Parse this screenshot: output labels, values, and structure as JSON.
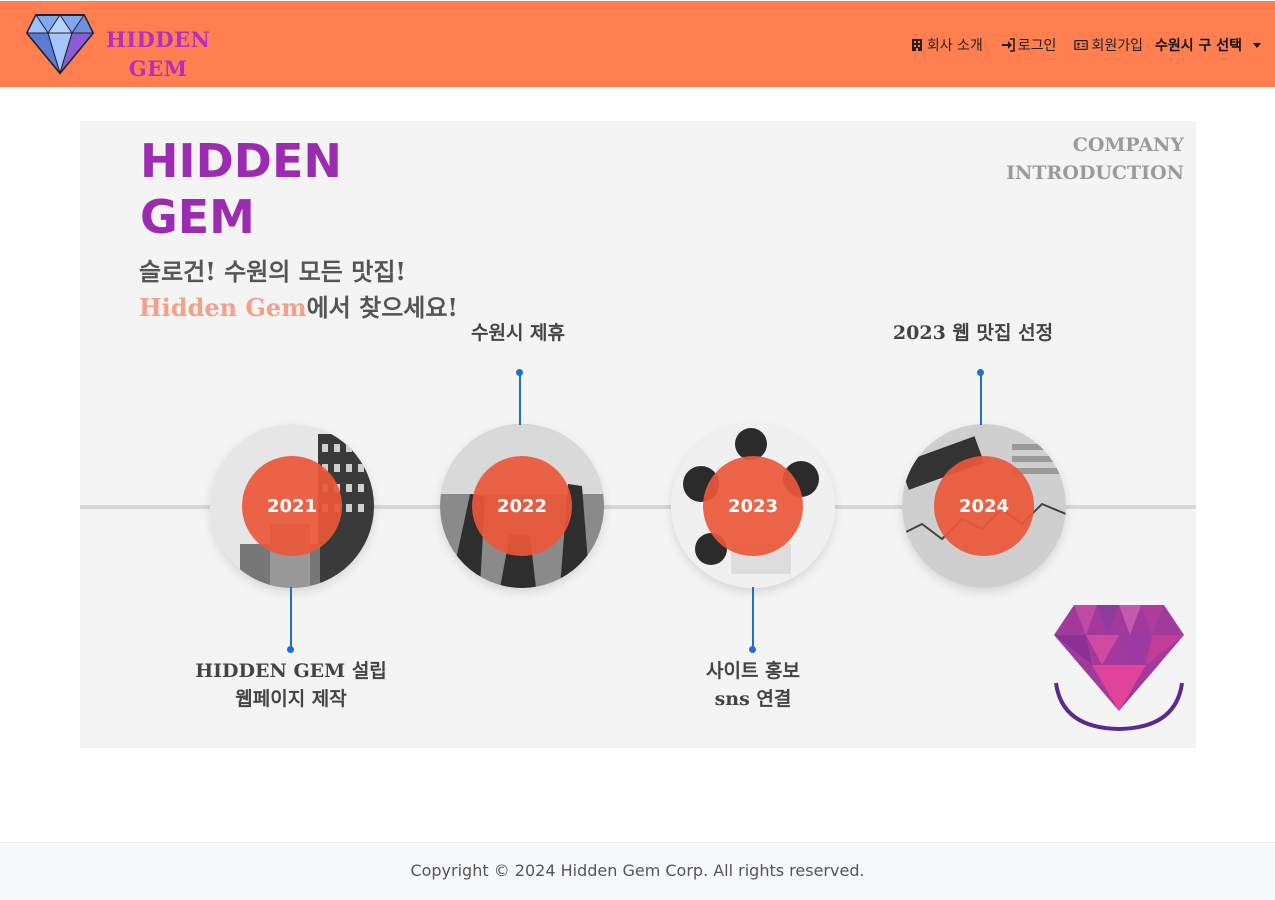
{
  "navbar": {
    "brand_line1": "HIDDEN",
    "brand_line2": "GEM",
    "brand_color": "#b42fc0",
    "background_color": "#ff7f50",
    "links": [
      {
        "label": "회사 소개",
        "icon": "building-icon"
      },
      {
        "label": "로그인",
        "icon": "sign-in-icon"
      },
      {
        "label": "회원가입",
        "icon": "id-card-icon"
      }
    ],
    "dropdown_label": "수원시 구 선택"
  },
  "hero": {
    "title_line1": "HIDDEN",
    "title_line2": "GEM",
    "slogan_line1": "슬로건! 수원의 모든 맛집!",
    "slogan_accent": "Hidden Gem",
    "slogan_line2_rest": "에서 찾으세요!",
    "company_line1": "COMPANY",
    "company_line2": "INTRODUCTION",
    "timeline": [
      {
        "year": "2021",
        "label_lines": [
          "HIDDEN GEM 설립",
          "웹페이지 제작"
        ]
      },
      {
        "year": "2022",
        "label_lines": [
          "수원시 제휴"
        ]
      },
      {
        "year": "2023",
        "label_lines": [
          "사이트 홍보",
          "sns 연결"
        ]
      },
      {
        "year": "2024",
        "label_lines": [
          "2023 웹 맛집 선정"
        ]
      }
    ],
    "year_circle_color": "#eb583a",
    "title_color": "#9b2cb0"
  },
  "footer": {
    "copyright": "Copyright © 2024 Hidden Gem Corp. All rights reserved."
  }
}
